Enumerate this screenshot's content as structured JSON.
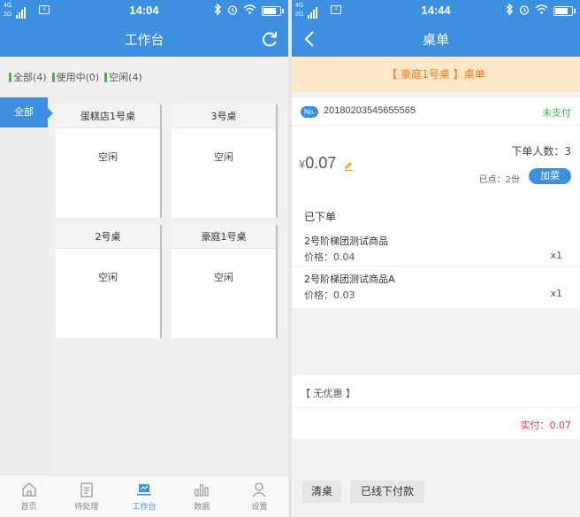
{
  "status_left": {
    "network": [
      "4G",
      "2G"
    ],
    "time": "14:04"
  },
  "status_right": {
    "network": [
      "4G",
      "2G"
    ],
    "time": "14:44"
  },
  "left": {
    "title": "工作台",
    "filters": [
      "全部(4)",
      "使用中(0)",
      "空闲(4)"
    ],
    "categories": [
      "全部"
    ],
    "tables": [
      {
        "name": "蛋糕店1号桌",
        "status": "空闲"
      },
      {
        "name": "3号桌",
        "status": "空闲"
      },
      {
        "name": "2号桌",
        "status": "空闲"
      },
      {
        "name": "豪庭1号桌",
        "status": "空闲"
      }
    ],
    "tabs": [
      {
        "label": "首页",
        "icon": "home-icon",
        "active": false
      },
      {
        "label": "待处理",
        "icon": "clipboard-icon",
        "active": false
      },
      {
        "label": "工作台",
        "icon": "laptop-icon",
        "active": true
      },
      {
        "label": "数据",
        "icon": "bar-chart-icon",
        "active": false
      },
      {
        "label": "设置",
        "icon": "user-icon",
        "active": false
      }
    ]
  },
  "right": {
    "title": "桌单",
    "banner": "【 豪庭1号桌 】桌单",
    "order_badge": "No.",
    "order_no": "20180203545655565",
    "pay_status": "未支付",
    "persons": "下单人数：3",
    "currency": "¥",
    "amount": "0.07",
    "ordered": "已点：2份",
    "add_button": "加菜",
    "section_title": "已下单",
    "items": [
      {
        "name": "2号阶梯团测试商品",
        "price": "价格：0.04",
        "qty": "x1"
      },
      {
        "name": "2号阶梯团测试商品A",
        "price": "价格：0.03",
        "qty": "x1"
      }
    ],
    "discount": "【 无优惠 】",
    "paid": "实付：0.07",
    "clear_button": "清桌",
    "offline_pay_button": "已线下付款"
  },
  "colors": {
    "primary": "#3d8fe0",
    "banner_bg": "#fde7c9",
    "banner_text": "#f07a18",
    "success": "#4caf50",
    "danger": "#e53935"
  }
}
